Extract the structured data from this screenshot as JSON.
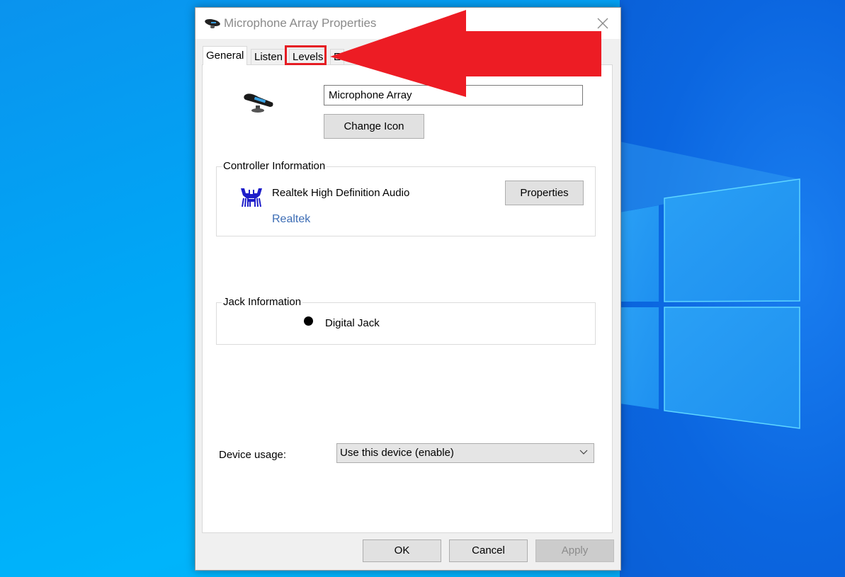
{
  "window": {
    "title": "Microphone Array Properties",
    "close_icon": "close-icon"
  },
  "tabs": [
    {
      "label": "General",
      "active": true
    },
    {
      "label": "Listen",
      "active": false
    },
    {
      "label": "Levels",
      "active": false,
      "highlighted": true
    },
    {
      "label": "E",
      "active": false,
      "partially_hidden": true
    }
  ],
  "general": {
    "device_icon": "microphone-array-icon",
    "device_name_value": "Microphone Array",
    "change_icon_label": "Change Icon",
    "change_icon_accel": "I"
  },
  "controller": {
    "group_label": "Controller Information",
    "icon": "realtek-crab-icon",
    "name": "Realtek High Definition Audio",
    "vendor_link": "Realtek",
    "properties_label": "Properties",
    "properties_accel": "P"
  },
  "jack": {
    "group_label": "Jack Information",
    "items": [
      {
        "icon": "jack-dot-icon",
        "label": "Digital Jack"
      }
    ]
  },
  "usage": {
    "label": "Device usage:",
    "selected": "Use this device (enable)"
  },
  "footer": {
    "ok_label": "OK",
    "cancel_label": "Cancel",
    "apply_label": "Apply",
    "apply_enabled": false
  },
  "annotation": {
    "arrow_color": "#ed1c24",
    "target": "Levels"
  },
  "colors": {
    "link": "#3d6db5",
    "title_text": "#8a8a8a",
    "dialog_bg": "#f0f0f0"
  }
}
